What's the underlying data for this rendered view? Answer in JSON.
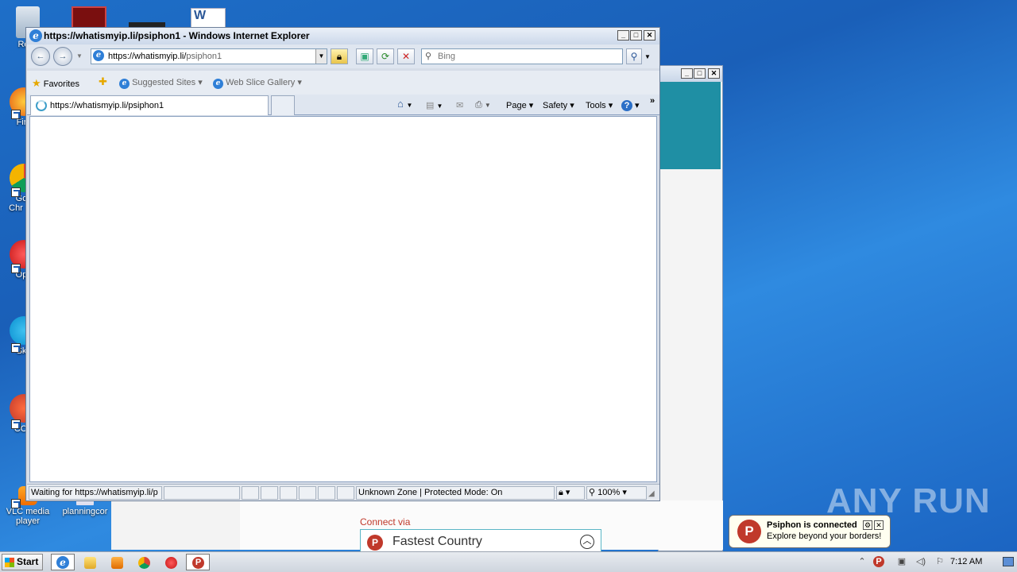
{
  "ie": {
    "title": "https://whatismyip.li/psiphon1 - Windows Internet Explorer",
    "address_main": "https://whatismyip.li/",
    "address_path": "psiphon1",
    "search_placeholder": "Bing",
    "favorites_label": "Favorites",
    "suggested_sites": "Suggested Sites",
    "web_slice_gallery": "Web Slice Gallery",
    "tab_label": "https://whatismyip.li/psiphon1",
    "commands": {
      "page": "Page",
      "safety": "Safety",
      "tools": "Tools"
    },
    "status_text": "Waiting for https://whatismyip.li/p",
    "zone_text": "Unknown Zone | Protected Mode: On",
    "zoom": "100%"
  },
  "psiphon_page": {
    "connect_via": "Connect via",
    "country": "Fastest Country"
  },
  "desktop": {
    "icons": [
      {
        "label": "Recy"
      },
      {
        "label": "Fir"
      },
      {
        "label": "Go\nChr"
      },
      {
        "label": "Op"
      },
      {
        "label": "Sk"
      },
      {
        "label": "CCl"
      },
      {
        "label": "VLC media\nplayer"
      },
      {
        "label": "planningcor"
      }
    ]
  },
  "balloon": {
    "title": "Psiphon is connected",
    "body": "Explore beyond your borders!"
  },
  "taskbar": {
    "start": "Start",
    "clock": "7:12 AM"
  },
  "watermark": "ANY RUN",
  "colors": {
    "desktop": "#1e6fc8",
    "psiphon_red": "#c0392b",
    "psiphon_teal": "#1f8fa4"
  }
}
